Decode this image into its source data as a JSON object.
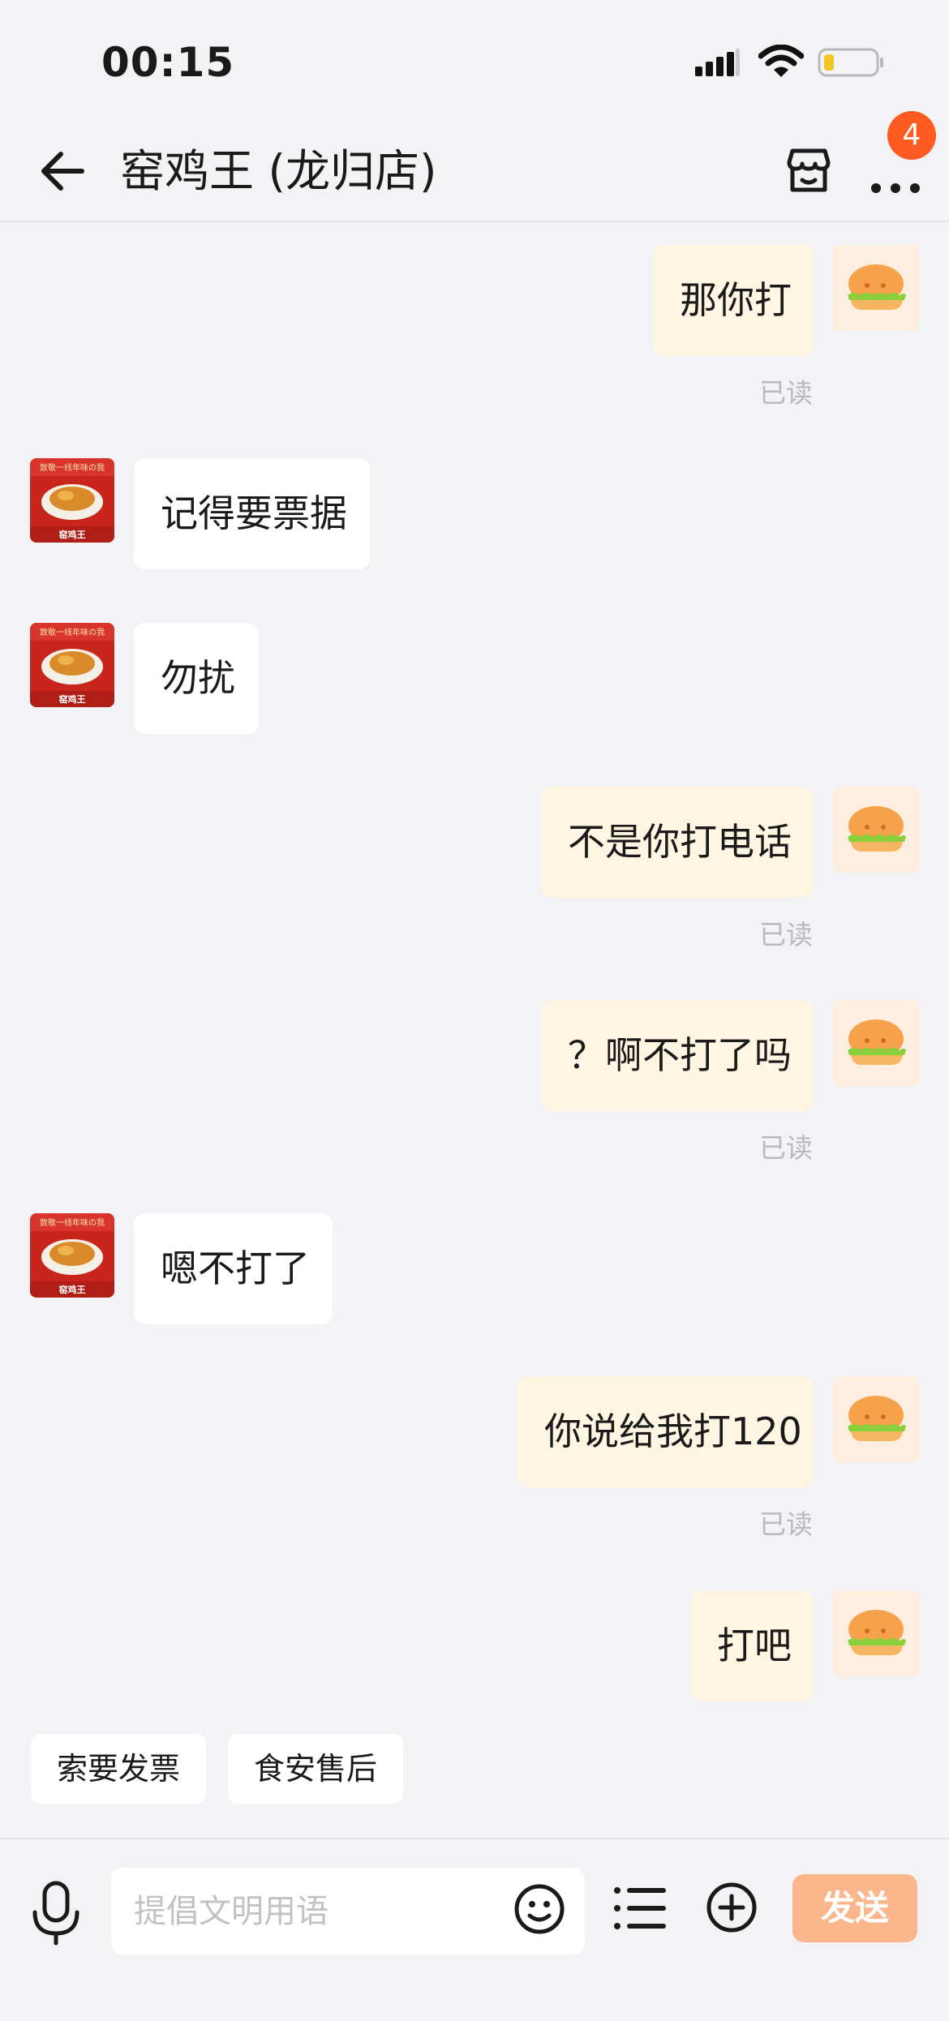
{
  "status_bar": {
    "time": "00:15"
  },
  "header": {
    "title": "窑鸡王 (龙归店)",
    "badge_count": "4"
  },
  "messages": [
    {
      "side": "out",
      "text": "那你打",
      "read": "已读"
    },
    {
      "side": "in",
      "text": "记得要票据"
    },
    {
      "side": "in",
      "text": "勿扰"
    },
    {
      "side": "out",
      "text": "不是你打电话",
      "read": "已读"
    },
    {
      "side": "out",
      "text": "？啊不打了吗",
      "read": "已读"
    },
    {
      "side": "in",
      "text": "嗯不打了"
    },
    {
      "side": "out",
      "text": "你说给我打120",
      "read": "已读"
    },
    {
      "side": "out",
      "text": "打吧"
    }
  ],
  "shop_avatar": {
    "banner_text": "致敬一线年味の我",
    "brand": "窑鸡王"
  },
  "quick_replies": [
    "索要发票",
    "食安售后"
  ],
  "input": {
    "placeholder": "提倡文明用语",
    "value": ""
  },
  "send_label": "发送",
  "colors": {
    "accent": "#ff5a1f",
    "send": "#fbb68c",
    "out_bubble": "#fff5e3"
  }
}
